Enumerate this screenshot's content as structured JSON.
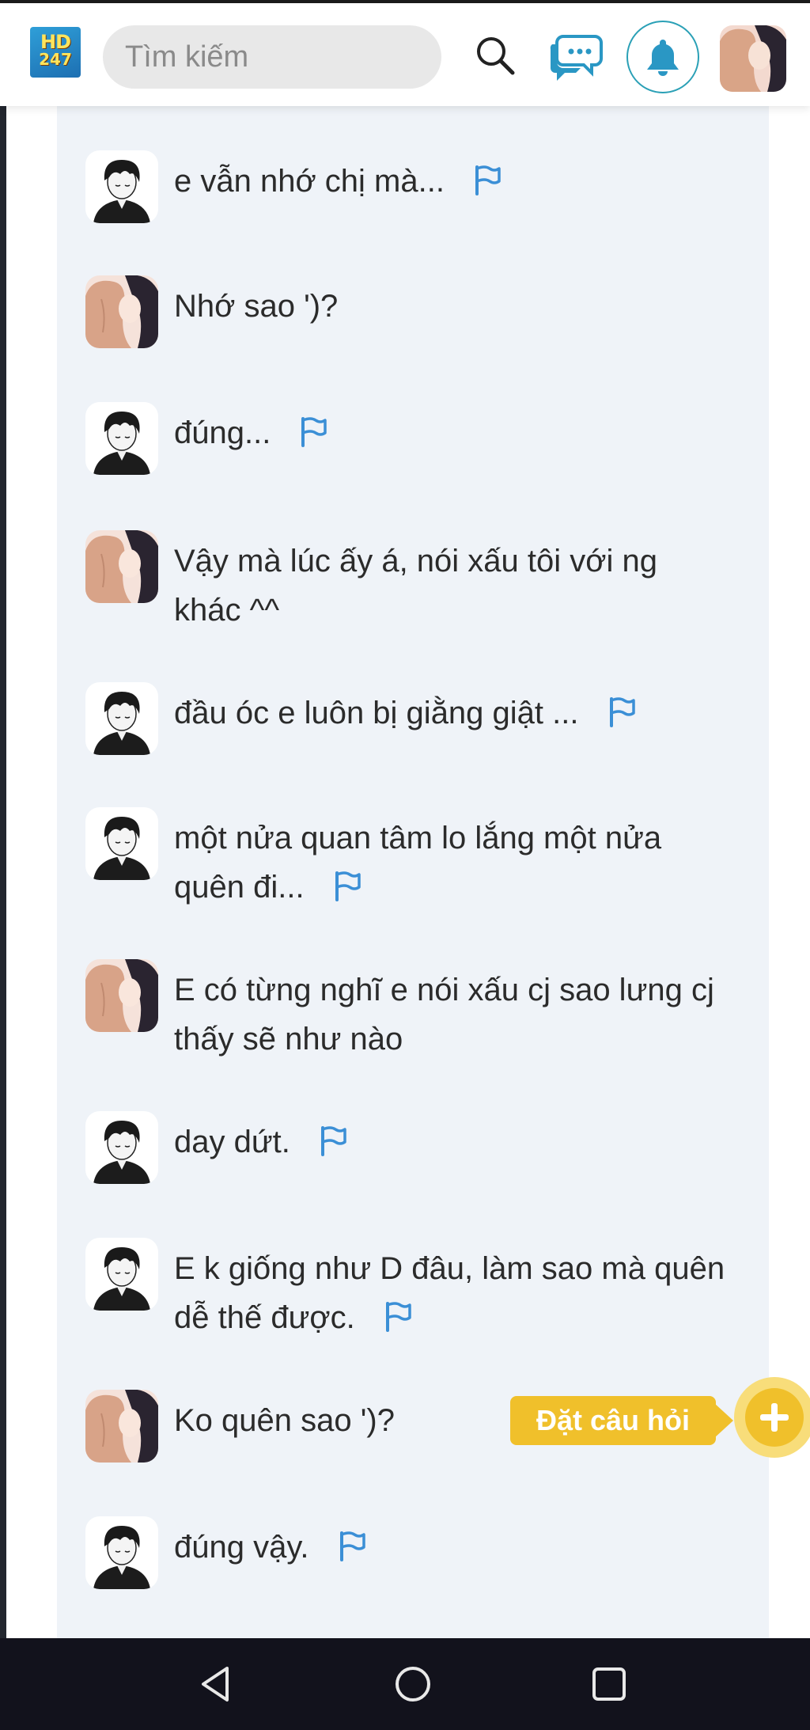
{
  "header": {
    "logo": {
      "line1": "HD",
      "line2": "247"
    },
    "search": {
      "placeholder": "Tìm kiếm"
    },
    "icons": [
      "search-icon",
      "chat-icon",
      "bell-icon",
      "avatar"
    ]
  },
  "messages": [
    {
      "author": "boy",
      "text": "e vẫn nhớ chị mà...",
      "flag": true
    },
    {
      "author": "girl",
      "text": "Nhớ sao ')?",
      "flag": false
    },
    {
      "author": "boy",
      "text": "đúng...",
      "flag": true
    },
    {
      "author": "girl",
      "text": "Vậy mà lúc ấy á, nói xấu tôi với ng khác ^^",
      "flag": false
    },
    {
      "author": "boy",
      "text": "đầu óc e luôn bị giằng giật ...",
      "flag": true
    },
    {
      "author": "boy",
      "text": "một nửa quan tâm lo lắng một nửa quên đi...",
      "flag": true
    },
    {
      "author": "girl",
      "text": "E có từng nghĩ e nói xấu cj sao lưng cj thấy sẽ như nào",
      "flag": false
    },
    {
      "author": "boy",
      "text": "day dứt.",
      "flag": true
    },
    {
      "author": "boy",
      "text": "E k giống như D đâu, làm sao mà quên dễ thế được.",
      "flag": true
    },
    {
      "author": "girl",
      "text": "Ko quên sao ')?",
      "flag": false
    },
    {
      "author": "boy",
      "text": "đúng vậy.",
      "flag": true
    }
  ],
  "ask_question": {
    "label": "Đặt câu hỏi"
  },
  "colors": {
    "accent_yellow": "#f0c02b",
    "flag_blue": "#3b8fd6",
    "panel_bg": "#eff3f8",
    "navbar": "#12121c"
  },
  "navbar": {
    "buttons": [
      "back-icon",
      "home-icon",
      "recents-icon"
    ]
  }
}
